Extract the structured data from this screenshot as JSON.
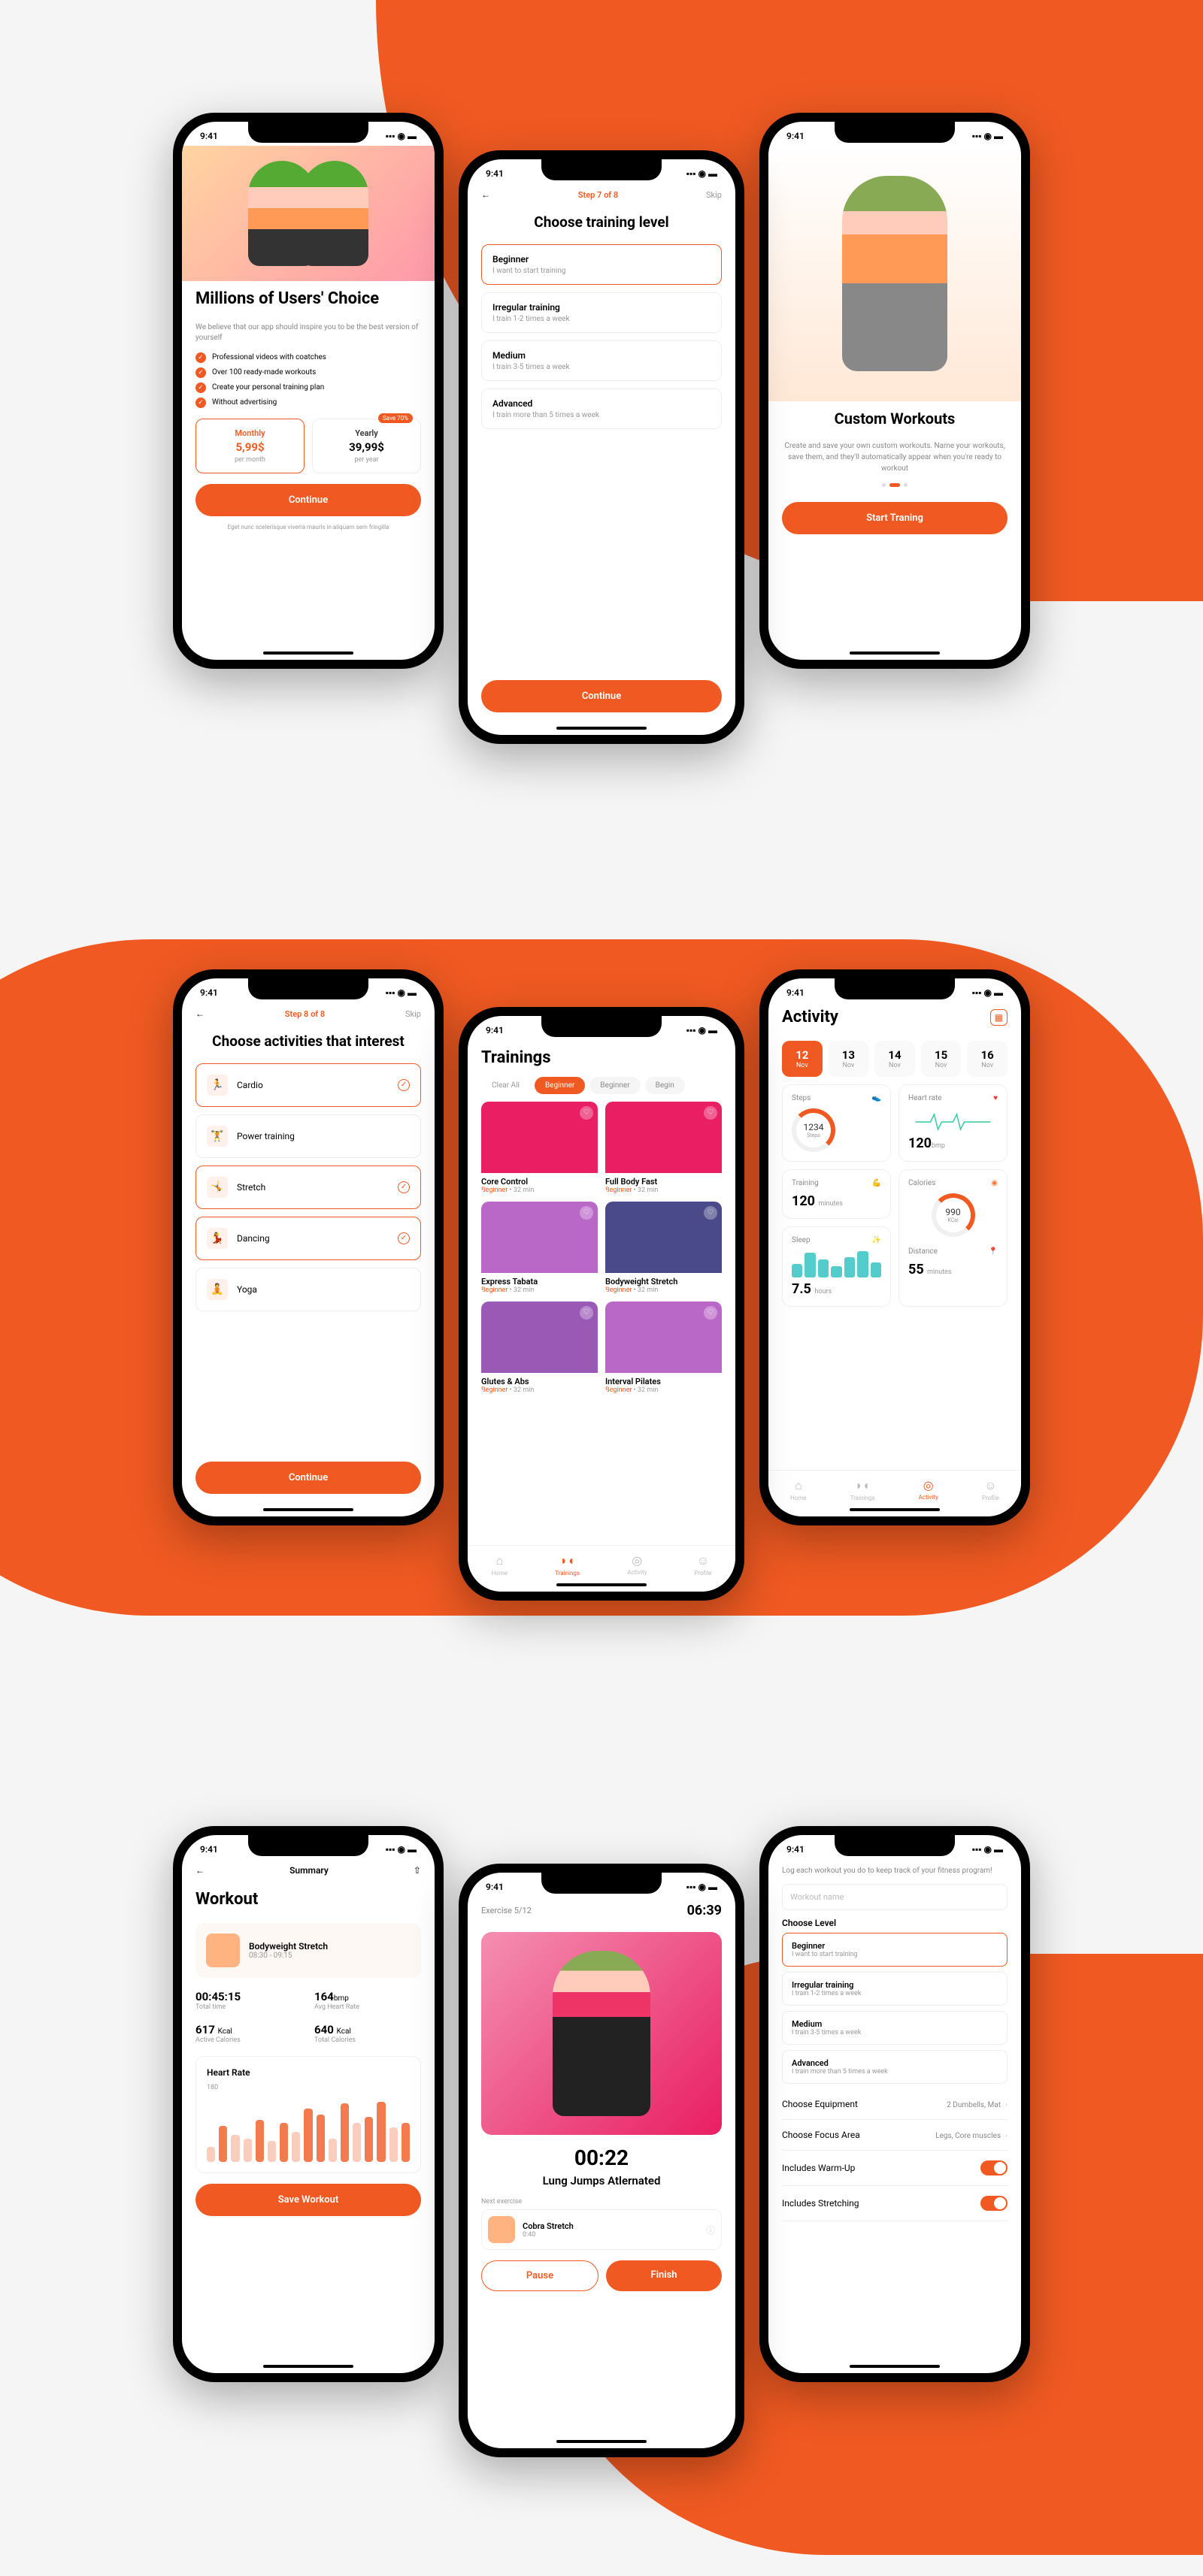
{
  "status": {
    "time": "9:41",
    "sig": "▪▪▪",
    "wifi": "◉",
    "bat": "▬"
  },
  "s1": {
    "title": "Millions of Users' Choice",
    "sub": "We believe that our app should inspire you to be the best version of yourself",
    "b1": "Professional videos with coatches",
    "b2": "Over 100 ready-made workouts",
    "b3": "Create your personal training plan",
    "b4": "Without advertising",
    "monthly": "Monthly",
    "mprice": "5,99$",
    "mper": "per month",
    "yearly": "Yearly",
    "yprice": "39,99$",
    "yper": "per year",
    "save": "Save 70%",
    "btn": "Continue",
    "fine": "Eget nunc scelerisque viverra mauris in aliquam sem fringilla"
  },
  "s2": {
    "step": "Step 7 of 8",
    "skip": "Skip",
    "title": "Choose training level",
    "l1": {
      "t": "Beginner",
      "s": "I want to start training"
    },
    "l2": {
      "t": "Irregular training",
      "s": "I train 1-2 times a week"
    },
    "l3": {
      "t": "Medium",
      "s": "I train 3-5 times a week"
    },
    "l4": {
      "t": "Advanced",
      "s": "I train more than 5 times a week"
    },
    "btn": "Continue"
  },
  "s3": {
    "title": "Custom Workouts",
    "desc": "Create and save your own custom workouts. Name your workouts, save them, and they'll automatically appear when you're ready to workout",
    "btn": "Start Traning"
  },
  "s4": {
    "step": "Step 8 of 8",
    "skip": "Skip",
    "title": "Choose activities that interest",
    "a1": "Cardio",
    "a2": "Power training",
    "a3": "Stretch",
    "a4": "Dancing",
    "a5": "Yoga",
    "btn": "Continue"
  },
  "s5": {
    "title": "Trainings",
    "clear": "Clear All",
    "f1": "Beginner",
    "f2": "Beginner",
    "f3": "Begin",
    "c1": {
      "n": "Core Control",
      "m": "Beginner",
      "d": "32 min"
    },
    "c2": {
      "n": "Full Body Fast",
      "m": "Beginner",
      "d": "32 min"
    },
    "c3": {
      "n": "Express Tabata",
      "m": "Beginner",
      "d": "32 min"
    },
    "c4": {
      "n": "Bodyweight Stretch",
      "m": "Beginner",
      "d": "32 min"
    },
    "c5": {
      "n": "Glutes & Abs",
      "m": "Beginner",
      "d": "32 min"
    },
    "c6": {
      "n": "Interval Pilates",
      "m": "Beginner",
      "d": "32 min"
    },
    "nav": {
      "home": "Home",
      "tr": "Trainings",
      "act": "Activity",
      "pr": "Profile"
    }
  },
  "s6": {
    "title": "Activity",
    "d1": {
      "d": "12",
      "m": "Nov"
    },
    "d2": {
      "d": "13",
      "m": "Nov"
    },
    "d3": {
      "d": "14",
      "m": "Nov"
    },
    "d4": {
      "d": "15",
      "m": "Nov"
    },
    "d5": {
      "d": "16",
      "m": "Nov"
    },
    "steps": {
      "l": "Steps",
      "v": "1234",
      "u": "Steps"
    },
    "hr": {
      "l": "Heart rate",
      "v": "120",
      "u": "bmp"
    },
    "tr": {
      "l": "Training",
      "v": "120",
      "u": "minutes"
    },
    "cal": {
      "l": "Calories",
      "v": "990",
      "u": "KCal"
    },
    "sl": {
      "l": "Sleep",
      "v": "7.5",
      "u": "hours"
    },
    "di": {
      "l": "Distance",
      "v": "55",
      "u": "minutes"
    },
    "nav": {
      "home": "Home",
      "tr": "Trainings",
      "act": "Activity",
      "pr": "Profile"
    }
  },
  "s7": {
    "header": "Summary",
    "title": "Workout",
    "wname": "Bodyweight Stretch",
    "wtime": "08:30 - 09:15",
    "m1": {
      "v": "00:45:15",
      "l": "Total time"
    },
    "m2": {
      "v": "164",
      "u": "bmp",
      "l": "Avg Heart Rate"
    },
    "m3": {
      "v": "617",
      "u": "Kcal",
      "l": "Active Calories"
    },
    "m4": {
      "v": "640",
      "u": "Kcal",
      "l": "Total Calories"
    },
    "hrtitle": "Heart Rate",
    "hrmax": "180",
    "btn": "Save Workout"
  },
  "s8": {
    "ex": "Exercise 5/12",
    "tt": "06:39",
    "timer": "00:22",
    "name": "Lung Jumps Atlernated",
    "next": "Next exercise",
    "nname": "Cobra Stretch",
    "ntime": "0:40",
    "pause": "Pause",
    "finish": "Finish"
  },
  "s9": {
    "desc": "Log each workout you do to keep track of your fitness program!",
    "ph": "Workout name",
    "lvl": "Choose Level",
    "l1": {
      "t": "Beginner",
      "s": "I want to start training"
    },
    "l2": {
      "t": "Irregular training",
      "s": "I train 1-2 times a week"
    },
    "l3": {
      "t": "Medium",
      "s": "I train 3-5 times a week"
    },
    "l4": {
      "t": "Advanced",
      "s": "I train more than 5 times a week"
    },
    "eq": {
      "l": "Choose Equipment",
      "v": "2 Dumbells, Mat"
    },
    "fa": {
      "l": "Choose Focus Area",
      "v": "Legs, Core muscles"
    },
    "wu": "Includes Warm-Up",
    "st": "Includes Stretching"
  },
  "chart_data": [
    {
      "type": "bar",
      "title": "Heart Rate",
      "ylim": [
        0,
        180
      ],
      "values": [
        40,
        95,
        70,
        60,
        110,
        55,
        105,
        80,
        140,
        125,
        60,
        155,
        105,
        120,
        160,
        90,
        105
      ]
    },
    {
      "type": "bar",
      "title": "Sleep",
      "values": [
        50,
        90,
        65,
        40,
        75,
        95,
        55
      ]
    }
  ]
}
